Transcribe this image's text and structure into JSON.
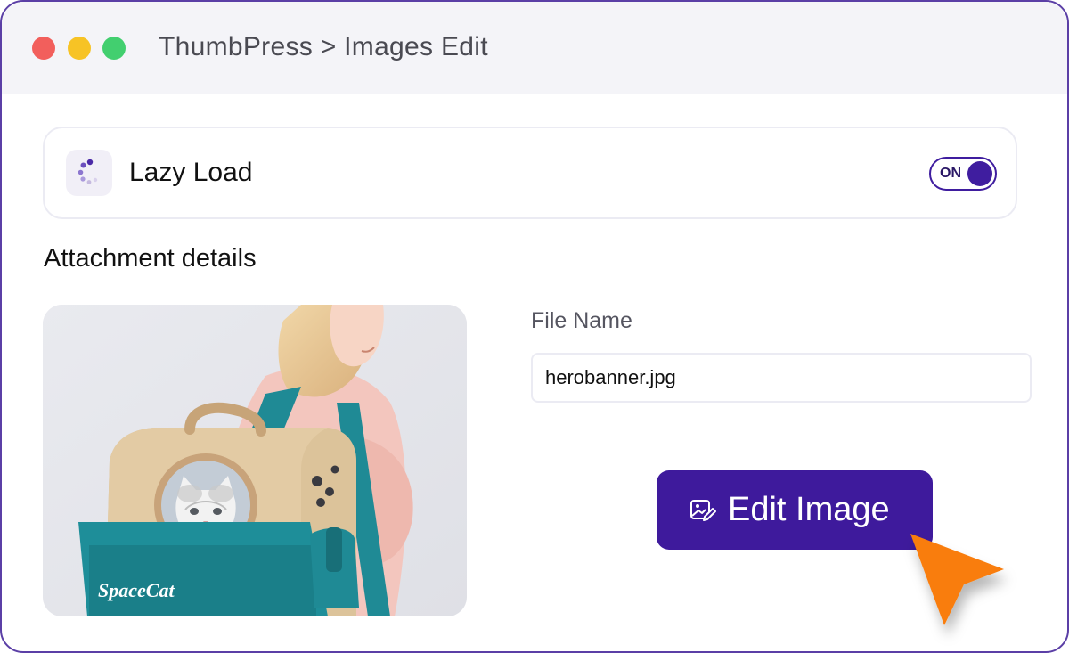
{
  "window": {
    "title": "ThumbPress > Images Edit",
    "controls": {
      "close_color": "#f25f5c",
      "minimize_color": "#f7c325",
      "maximize_color": "#42cf6f"
    }
  },
  "lazy_load": {
    "label": "Lazy Load",
    "icon": "loading-spinner-icon",
    "toggle": {
      "state_label": "ON",
      "enabled": true
    }
  },
  "attachment": {
    "heading": "Attachment details",
    "preview_image": "woman-with-space-cat-backpack",
    "backpack_print": "SpaceCat",
    "file_name_label": "File Name",
    "file_name_value": "herobanner.jpg"
  },
  "actions": {
    "edit_image_label": "Edit Image",
    "edit_icon": "image-edit-icon"
  },
  "cursor_icon": "pointer-arrow-icon",
  "colors": {
    "accent": "#3e1a9c",
    "window_border": "#5b3fa6",
    "cursor": "#f97d0b"
  }
}
